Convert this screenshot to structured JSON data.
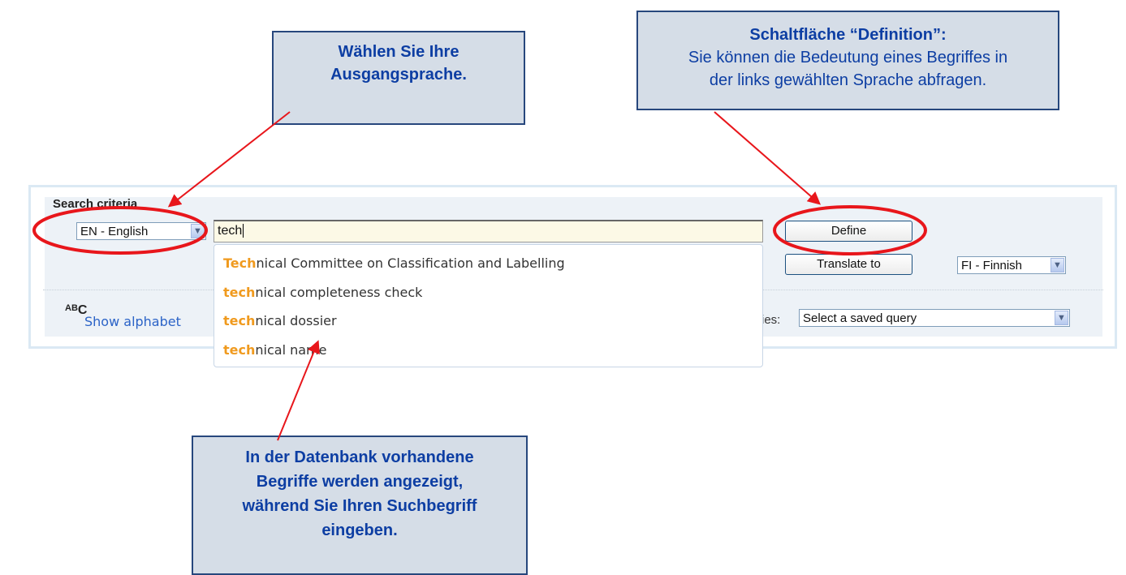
{
  "callouts": {
    "source": {
      "line1": "Wählen Sie Ihre",
      "line2": "Ausgangsprache."
    },
    "define": {
      "title": "Schaltfläche “Definition”:",
      "line1": "Sie können die Bedeutung eines Begriffes in",
      "line2": "der links gewählten Sprache abfragen."
    },
    "suggest": {
      "line1": "In der Datenbank vorhandene",
      "line2": "Begriffe werden angezeigt,",
      "line3": "während Sie Ihren Suchbegriff",
      "line4": "eingeben."
    }
  },
  "panel": {
    "title": "Search criteria",
    "source_language": "EN - English",
    "search_value": "tech",
    "define_label": "Define",
    "translate_label": "Translate to",
    "target_language": "FI - Finnish",
    "show_alphabet_label": "Show alphabet",
    "saved_queries_label": "ies:",
    "saved_query_value": "Select a saved query",
    "abc_icon_text": {
      "a": "A",
      "b": "B",
      "c": "C"
    }
  },
  "suggestions": [
    {
      "match": "Tech",
      "rest": "nical Committee on Classification and Labelling"
    },
    {
      "match": "tech",
      "rest": "nical completeness check"
    },
    {
      "match": "tech",
      "rest": "nical dossier"
    },
    {
      "match": "tech",
      "rest": "nical name"
    }
  ],
  "colors": {
    "annotation_red": "#e8161b",
    "highlight_orange": "#f09a1e",
    "callout_text": "#0d3ea3",
    "link_blue": "#2b63c7"
  }
}
